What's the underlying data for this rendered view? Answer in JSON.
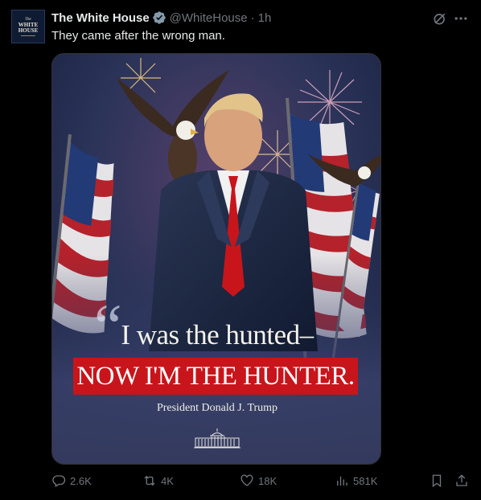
{
  "post": {
    "avatar": {
      "line1": "The",
      "line2": "WHITE",
      "line3": "HOUSE"
    },
    "author_name": "The White House",
    "handle": "@WhiteHouse",
    "separator": "·",
    "time": "1h",
    "text": "They came after the wrong man.",
    "verified_color": "#829aab"
  },
  "image": {
    "quote_mark": "“",
    "line1": "I was the hunted–",
    "line2": "NOW I'M THE HUNTER.",
    "attribution": "President Donald J. Trump",
    "accent_red": "#c8151b"
  },
  "actions": {
    "replies": "2.6K",
    "reposts": "4K",
    "likes": "18K",
    "views": "581K"
  },
  "icons": [
    "verified-badge-icon",
    "grok-icon",
    "more-icon",
    "reply-icon",
    "repost-icon",
    "like-icon",
    "views-icon",
    "bookmark-icon",
    "share-icon"
  ]
}
